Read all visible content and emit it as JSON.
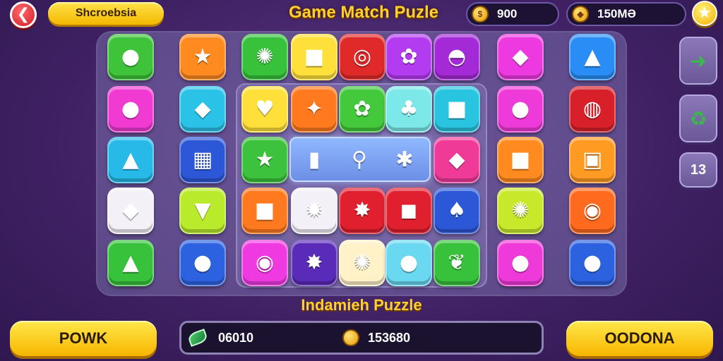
{
  "header": {
    "back_icon": "arrow-left-icon",
    "back_glyph": "❮",
    "mode_label": "Shcroebsia",
    "title": "Game Match Puzle",
    "coins": "900",
    "gems": "150MƏ",
    "star_glyph": "★"
  },
  "board": {
    "tiles": [
      {
        "icon": "lemon-icon",
        "glyph": "●",
        "color": "#3ec33a"
      },
      {
        "icon": "star-icon",
        "glyph": "★",
        "color": "#ff8a1f"
      },
      {
        "icon": "sun-face-icon",
        "glyph": "✺",
        "color": "#38c23c"
      },
      {
        "icon": "pink-cube-icon",
        "glyph": "■",
        "color": "#ffe03a"
      },
      {
        "icon": "donut-icon",
        "glyph": "◎",
        "color": "#e02a2a"
      },
      {
        "icon": "purple-flower-icon",
        "glyph": "✿",
        "color": "#b43cf0"
      },
      {
        "icon": "muffin-icon",
        "glyph": "◓",
        "color": "#a32ad6"
      },
      {
        "icon": "yellow-box-icon",
        "glyph": "◆",
        "color": "#ec3ae0"
      },
      {
        "icon": "yellow-drop-icon",
        "glyph": "▲",
        "color": "#2a8df5"
      },
      {
        "icon": "plum-icon",
        "glyph": "●",
        "color": "#f03ad2"
      },
      {
        "icon": "blue-gem-icon",
        "glyph": "◆",
        "color": "#2bc2e8"
      },
      {
        "icon": "red-heart-icon",
        "glyph": "♥",
        "color": "#ffe03a"
      },
      {
        "icon": "blue-bird-icon",
        "glyph": "✦",
        "color": "#ff7a1e"
      },
      {
        "icon": "yellow-flower-icon",
        "glyph": "✿",
        "color": "#44c83c"
      },
      {
        "icon": "green-dino-icon",
        "glyph": "♣",
        "color": "#7de8e8"
      },
      {
        "icon": "green-box-icon",
        "glyph": "■",
        "color": "#29c4df"
      },
      {
        "icon": "apple-icon",
        "glyph": "●",
        "color": "#ee3ad8"
      },
      {
        "icon": "candy-icon",
        "glyph": "◍",
        "color": "#d8202a"
      },
      {
        "icon": "yellow-drop-icon",
        "glyph": "▲",
        "color": "#27b9e8"
      },
      {
        "icon": "castle-icon",
        "glyph": "▦",
        "color": "#2c58d8"
      },
      {
        "icon": "green-star-icon",
        "glyph": "★",
        "color": "#3cc23c"
      },
      {
        "icon": "pink-gem-icon",
        "glyph": "◆",
        "color": "#f03a98"
      },
      {
        "icon": "blue-book-icon",
        "glyph": "■",
        "color": "#ff8a1f"
      },
      {
        "icon": "green-gadget-icon",
        "glyph": "▣",
        "color": "#ff9a22"
      },
      {
        "icon": "purple-leaf-icon",
        "glyph": "◆",
        "color": "#f4f0f8"
      },
      {
        "icon": "carrot-icon",
        "glyph": "▼",
        "color": "#b9ea2c"
      },
      {
        "icon": "teal-book-icon",
        "glyph": "■",
        "color": "#ff7a1e"
      },
      {
        "icon": "orange-sun-icon",
        "glyph": "✹",
        "color": "#f4f0f8"
      },
      {
        "icon": "burst-cube-icon",
        "glyph": "✸",
        "color": "#e0202e"
      },
      {
        "icon": "blue-robot-icon",
        "glyph": "◼",
        "color": "#e0202e"
      },
      {
        "icon": "green-tree-icon",
        "glyph": "♠",
        "color": "#2c58d8"
      },
      {
        "icon": "sun-face-icon",
        "glyph": "✺",
        "color": "#c8e82c"
      },
      {
        "icon": "blue-orb-icon",
        "glyph": "◉",
        "color": "#ff6a1e"
      },
      {
        "icon": "yellow-drop-icon",
        "glyph": "▲",
        "color": "#38c23c"
      },
      {
        "icon": "duck-icon",
        "glyph": "●",
        "color": "#2c62e0"
      },
      {
        "icon": "pink-monster-icon",
        "glyph": "◉",
        "color": "#ee3ae0"
      },
      {
        "icon": "fireball-icon",
        "glyph": "✸",
        "color": "#5a2ab8"
      },
      {
        "icon": "sun-face-icon",
        "glyph": "✺",
        "color": "#fff2c8"
      },
      {
        "icon": "pink-blob-icon",
        "glyph": "●",
        "color": "#6ad8f0"
      },
      {
        "icon": "leaf-icon",
        "glyph": "❦",
        "color": "#38c23c"
      },
      {
        "icon": "red-apple-icon",
        "glyph": "●",
        "color": "#ee3ad8"
      },
      {
        "icon": "lemon-icon",
        "glyph": "●",
        "color": "#2c62e0"
      }
    ],
    "highlight_icons": [
      {
        "icon": "jar-icon",
        "glyph": "▮"
      },
      {
        "icon": "magnifier-icon",
        "glyph": "⚲"
      },
      {
        "icon": "bug-icon",
        "glyph": "✱"
      }
    ]
  },
  "side": {
    "button1_icon": "green-arrow-icon",
    "button1_glyph": "➜",
    "button2_icon": "recycle-icon",
    "button2_glyph": "♻",
    "count": "13"
  },
  "footer": {
    "subtitle": "Indamieh Puzzle",
    "left_button": "POWK",
    "moves_value": "06010",
    "score_value": "153680",
    "right_button": "OODONA"
  },
  "colors": {
    "accent_gold": "#ffcf2e",
    "background": "#3f2163",
    "button_yellow": "#f7b500"
  }
}
